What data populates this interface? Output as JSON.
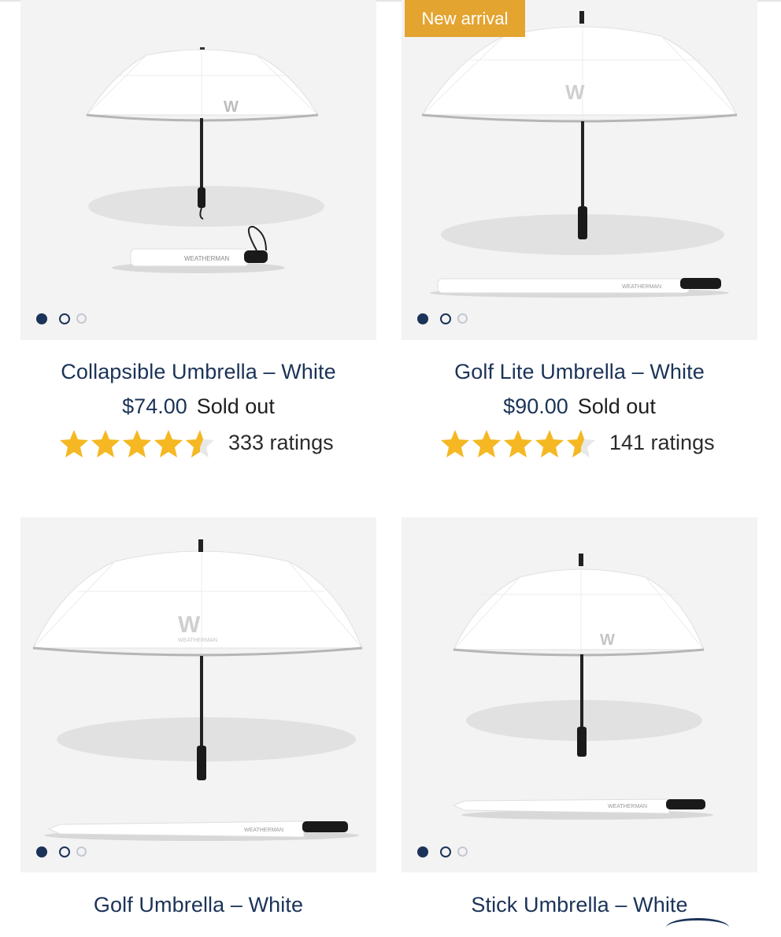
{
  "products": [
    {
      "title": "Collapsible Umbrella – White",
      "price": "$74.00",
      "status": "Sold out",
      "rating_count": "333 ratings",
      "rating": 4.5,
      "badge": "",
      "image_dots": 3,
      "active_dot": 1
    },
    {
      "title": "Golf Lite Umbrella – White",
      "price": "$90.00",
      "status": "Sold out",
      "rating_count": "141 ratings",
      "rating": 4.5,
      "badge": "New arrival",
      "image_dots": 3,
      "active_dot": 1
    },
    {
      "title": "Golf Umbrella – White",
      "image_dots": 3,
      "active_dot": 1
    },
    {
      "title": "Stick Umbrella – White",
      "image_dots": 3,
      "active_dot": 1
    }
  ],
  "colors": {
    "navy": "#1b3358",
    "badge": "#e3a430",
    "star": "#f5b823",
    "image_bg": "#f3f3f3"
  },
  "icons": {
    "star": "star-icon",
    "half_star": "half-star-icon",
    "dot": "carousel-dot-icon"
  }
}
